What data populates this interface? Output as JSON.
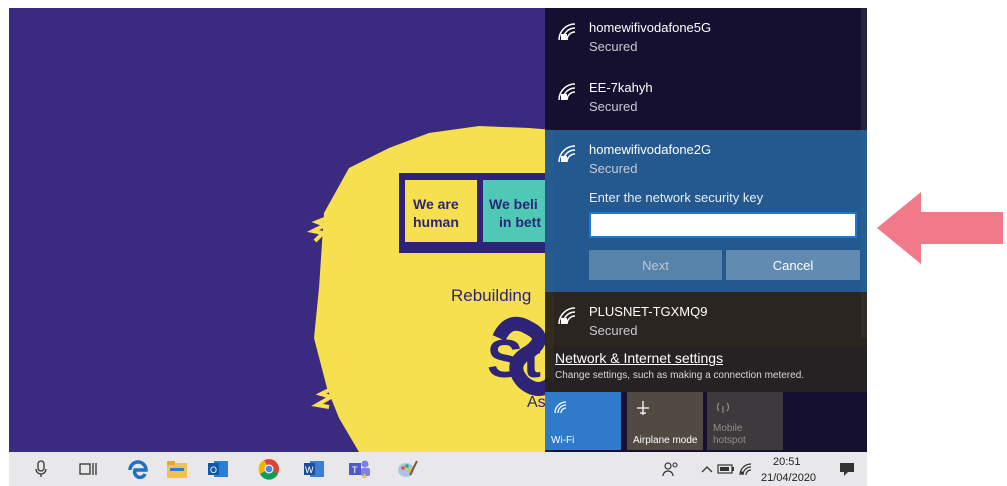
{
  "wallpaper": {
    "box1_line1": "We are",
    "box1_line2": "human",
    "box2_line1": "We beli",
    "box2_line2": "in bett",
    "headline": "Rebuilding",
    "logo_fragment": "St",
    "small_fragment": "As"
  },
  "networks": [
    {
      "ssid": "homewifivodafone5G",
      "status": "Secured"
    },
    {
      "ssid": "EE-7kahyh",
      "status": "Secured"
    },
    {
      "ssid": "homewifivodafone2G",
      "status": "Secured"
    },
    {
      "ssid": "PLUSNET-TGXMQ9",
      "status": "Secured"
    }
  ],
  "security_key": {
    "prompt": "Enter the network security key",
    "value": "",
    "next_label": "Next",
    "cancel_label": "Cancel"
  },
  "settings": {
    "link": "Network & Internet settings",
    "description": "Change settings, such as making a connection metered."
  },
  "quick_actions": {
    "wifi": "Wi-Fi",
    "airplane": "Airplane mode",
    "hotspot_line1": "Mobile",
    "hotspot_line2": "hotspot"
  },
  "taskbar": {
    "time": "20:51",
    "date": "21/04/2020",
    "icons": [
      "microphone-icon",
      "task-view-icon",
      "edge-icon",
      "file-explorer-icon",
      "outlook-icon",
      "chrome-icon",
      "word-icon",
      "teams-icon",
      "paint-icon"
    ],
    "tray_icons": [
      "people-icon",
      "chevron-up-icon",
      "battery-icon",
      "wifi-icon",
      "notification-icon"
    ]
  },
  "colors": {
    "wallpaper_bg": "#3a2a80",
    "highlight_yellow": "#f6e050",
    "active_network": "#2a6eaa",
    "wifi_tile": "#2f7bc9",
    "arrow": "#f07a8a"
  }
}
